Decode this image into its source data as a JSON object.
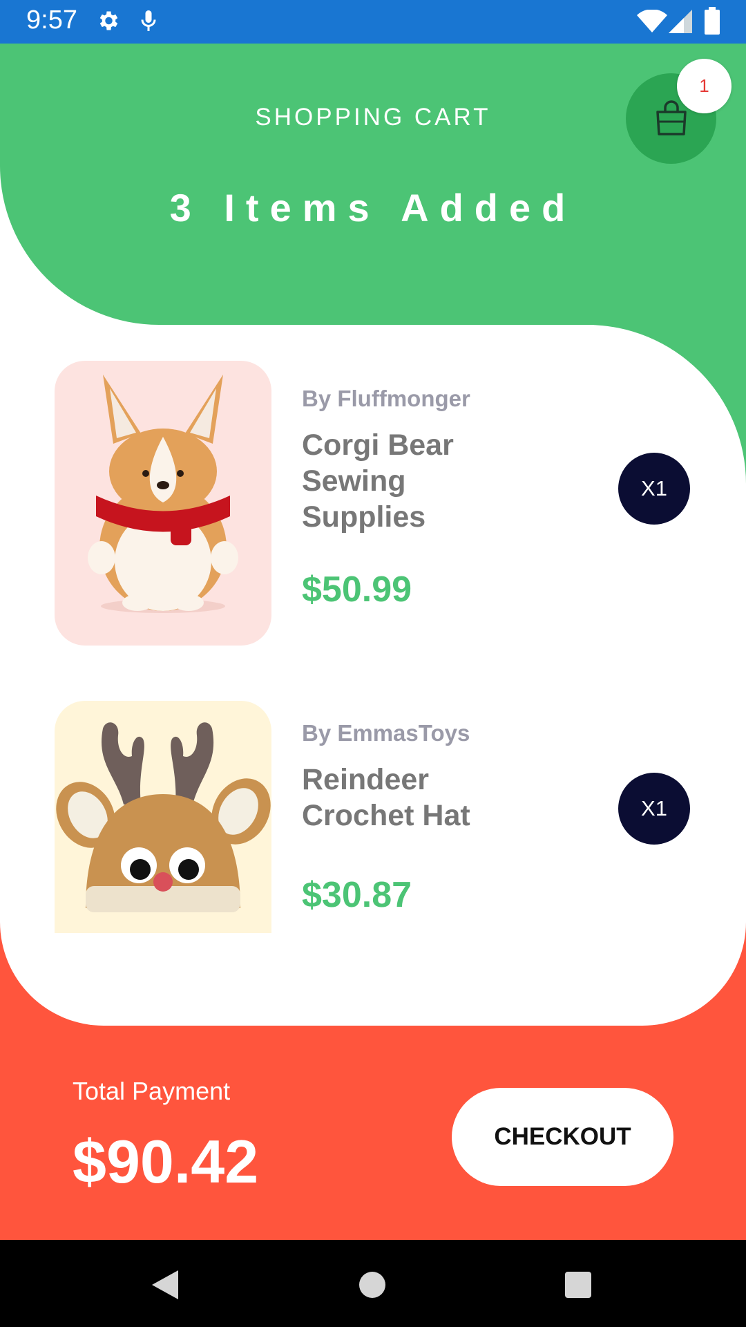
{
  "status_bar": {
    "time": "9:57",
    "icons": [
      "gear-icon",
      "mic-icon",
      "wifi-icon",
      "signal-icon",
      "battery-icon"
    ],
    "color": "#1976D2"
  },
  "header": {
    "title": "SHOPPING CART",
    "items_added": "3 Items Added",
    "cart_badge": "1",
    "accent_color": "#4CC475"
  },
  "items": [
    {
      "seller": "By Fluffmonger",
      "name": "Corgi Bear Sewing Supplies",
      "price": "$50.99",
      "quantity": "X1",
      "image": "corgi-bear-plush"
    },
    {
      "seller": "By EmmasToys",
      "name": "Reindeer Crochet Hat",
      "price": "$30.87",
      "quantity": "X1",
      "image": "reindeer-crochet-hat"
    }
  ],
  "footer": {
    "total_label": "Total Payment",
    "total_value": "$90.42",
    "checkout_label": "CHECKOUT",
    "color": "#FF553D"
  },
  "nav_bar": {
    "icons": [
      "back-icon",
      "home-icon",
      "recents-icon"
    ]
  }
}
